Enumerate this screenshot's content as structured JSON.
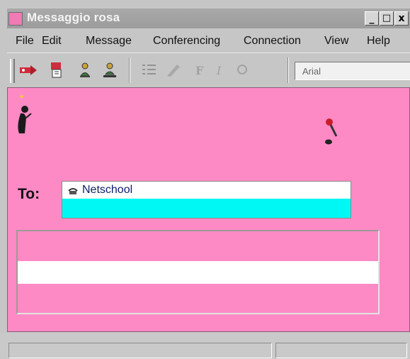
{
  "window": {
    "title": "Messaggio rosa",
    "controls": {
      "minimize": "_",
      "maximize": "□",
      "close": "x"
    }
  },
  "menu": [
    "File",
    "Edit",
    "Message",
    "Conferencing",
    "Connection",
    "View",
    "Help"
  ],
  "toolbar": {
    "icons": [
      "send-icon",
      "attach-icon",
      "user-icon",
      "user-list-icon",
      "bullet-list-icon",
      "format-icon",
      "bold-icon",
      "italic-icon",
      "underline-icon"
    ],
    "font": "Arial"
  },
  "compose": {
    "to_label": "To:",
    "recipient": "Netschool"
  },
  "colors": {
    "compose_background": "#fd8ac5",
    "selection": "#00f8f4"
  }
}
